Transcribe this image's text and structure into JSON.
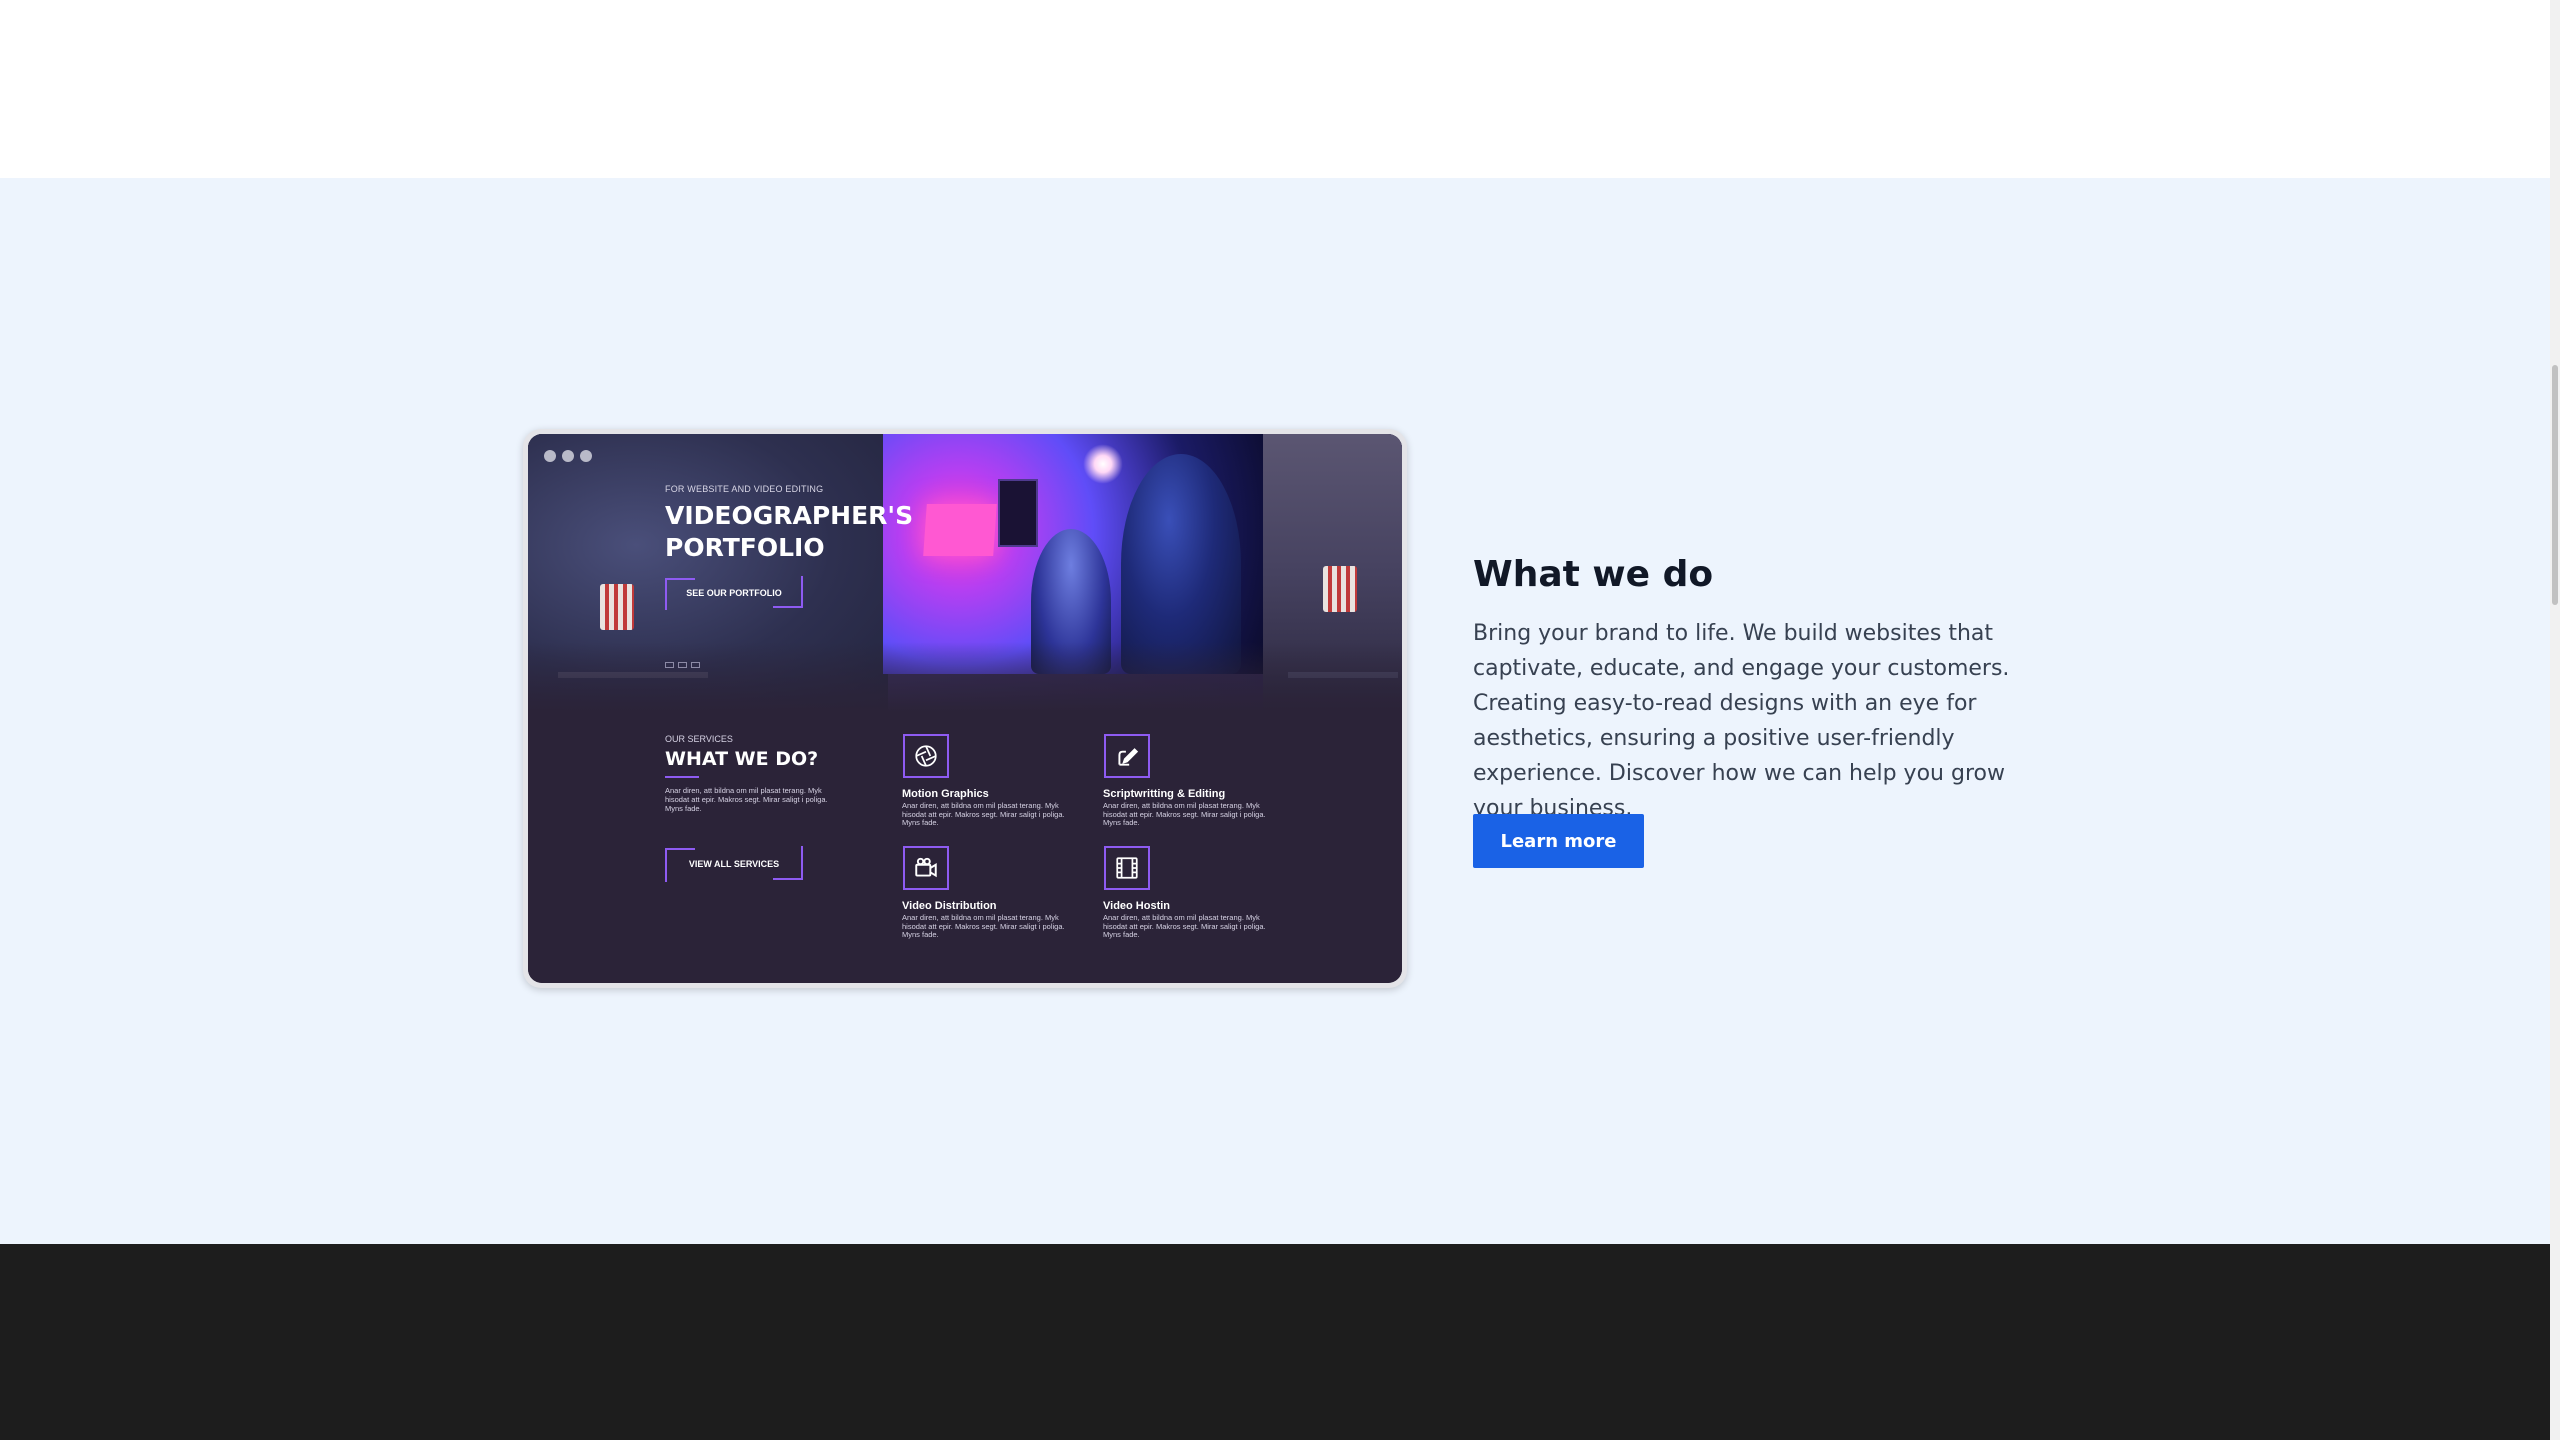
{
  "mockup": {
    "hero": {
      "kicker": "FOR WEBSITE AND VIDEO EDITING",
      "title": "VIDEOGRAPHER'S PORTFOLIO",
      "button": "SEE OUR PORTFOLIO"
    },
    "services": {
      "kicker": "OUR SERVICES",
      "title": "WHAT WE DO?",
      "description": "Anar diren, att bildna om mil plasat terang. Myk hisodat att epir. Makros segt. Mirar saligt i poliga. Myns fade.",
      "button": "VIEW ALL SERVICES",
      "items": [
        {
          "name": "Motion Graphics",
          "text": "Anar diren, att bildna om mil plasat terang. Myk hisodat att epir. Makros segt. Mirar saligt i poliga. Myns fade.",
          "icon": "aperture-icon"
        },
        {
          "name": "Scriptwritting & Editing",
          "text": "Anar diren, att bildna om mil plasat terang. Myk hisodat att epir. Makros segt. Mirar saligt i poliga. Myns fade.",
          "icon": "edit-icon"
        },
        {
          "name": "Video Distribution",
          "text": "Anar diren, att bildna om mil plasat terang. Myk hisodat att epir. Makros segt. Mirar saligt i poliga. Myns fade.",
          "icon": "video-camera-icon"
        },
        {
          "name": "Video Hostin",
          "text": "Anar diren, att bildna om mil plasat terang. Myk hisodat att epir. Makros segt. Mirar saligt i poliga. Myns fade.",
          "icon": "film-icon"
        }
      ]
    }
  },
  "section": {
    "title": "What we do",
    "body": "Bring your brand to life. We build websites that captivate, educate, and engage your customers. Creating easy-to-read designs with an eye for aesthetics, ensuring a positive user-friendly experience. Discover how we can help you grow your business.",
    "button": "Learn more"
  },
  "colors": {
    "section_bg": "#edf4fd",
    "footer_bg": "#1d1d1d",
    "accent": "#1a62e6",
    "mockup_purple": "#8e5bf2",
    "mockup_bg": "#2b2338"
  }
}
